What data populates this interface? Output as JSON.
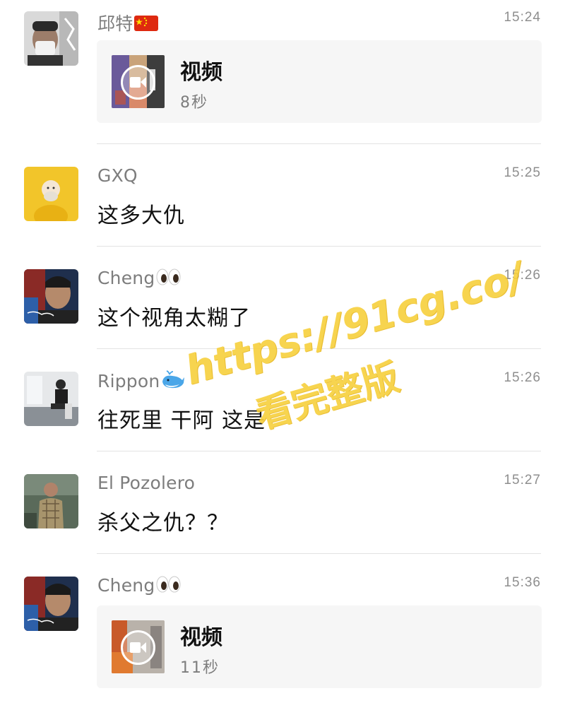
{
  "messages": [
    {
      "name": "邱特",
      "time": "15:24",
      "type": "video",
      "video_label": "视频",
      "duration": "8秒",
      "name_emoji": "china-flag-icon"
    },
    {
      "name": "GXQ",
      "time": "15:25",
      "type": "text",
      "text": "这多大仇"
    },
    {
      "name": "Cheng",
      "time": "15:26",
      "type": "text",
      "text": "这个视角太糊了",
      "name_emoji": "eyes-icon"
    },
    {
      "name": "Rippon",
      "time": "15:26",
      "type": "text",
      "text": "往死里 干阿 这是",
      "name_emoji": "whale-icon"
    },
    {
      "name": "El Pozolero",
      "time": "15:27",
      "type": "text",
      "text": "杀父之仇？？"
    },
    {
      "name": "Cheng",
      "time": "15:36",
      "type": "video",
      "video_label": "视频",
      "duration": "11秒",
      "name_emoji": "eyes-icon"
    }
  ],
  "watermark": {
    "url": "https://91cg.co/",
    "caption": "看完整版"
  }
}
